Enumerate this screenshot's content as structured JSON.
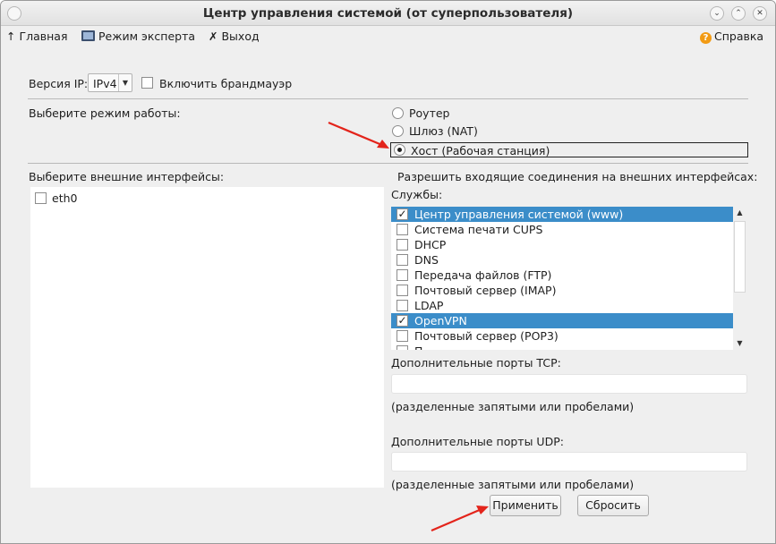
{
  "window": {
    "title": "Центр управления системой (от суперпользователя)"
  },
  "titlebar_buttons": {
    "minimize": "⌄",
    "maximize": "⌃",
    "close": "✕"
  },
  "toolbar": {
    "home_label": "Главная",
    "expert_label": "Режим эксперта",
    "exit_label": "Выход",
    "help_label": "Справка"
  },
  "ip": {
    "label": "Версия IP:",
    "value": "IPv4",
    "firewall_label": "Включить брандмауэр",
    "firewall_checked": false
  },
  "mode": {
    "label": "Выберите режим работы:",
    "options": [
      "Роутер",
      "Шлюз (NAT)",
      "Хост (Рабочая станция)"
    ],
    "selected": 2
  },
  "interfaces": {
    "label": "Выберите внешние интерфейсы:",
    "items": [
      {
        "name": "eth0",
        "checked": false
      }
    ]
  },
  "incoming": {
    "label": "Разрешить входящие соединения на внешних интерфейсах:",
    "services_label": "Службы:",
    "services": [
      {
        "name": "Центр управления системой (www)",
        "checked": true,
        "selected": true
      },
      {
        "name": "Система печати CUPS",
        "checked": false,
        "selected": false
      },
      {
        "name": "DHCP",
        "checked": false,
        "selected": false
      },
      {
        "name": "DNS",
        "checked": false,
        "selected": false
      },
      {
        "name": "Передача файлов (FTP)",
        "checked": false,
        "selected": false
      },
      {
        "name": "Почтовый сервер (IMAP)",
        "checked": false,
        "selected": false
      },
      {
        "name": "LDAP",
        "checked": false,
        "selected": false
      },
      {
        "name": "OpenVPN",
        "checked": true,
        "selected": true
      },
      {
        "name": "Почтовый сервер (POP3)",
        "checked": false,
        "selected": false
      },
      {
        "name": "П",
        "checked": false,
        "selected": false
      }
    ]
  },
  "tcp": {
    "label": "Дополнительные порты TCP:",
    "value": "",
    "hint": "(разделенные запятыми или пробелами)"
  },
  "udp": {
    "label": "Дополнительные порты UDP:",
    "value": "",
    "hint": "(разделенные запятыми или пробелами)"
  },
  "buttons": {
    "apply": "Применить",
    "reset": "Сбросить"
  },
  "colors": {
    "selection": "#3b8dc9",
    "annotation_arrow": "#e3241b"
  }
}
